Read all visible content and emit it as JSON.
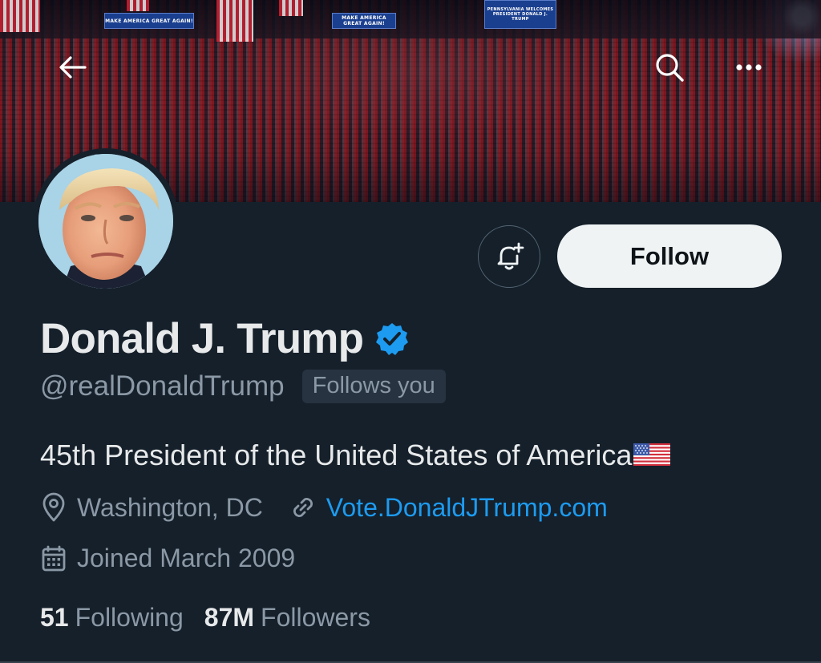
{
  "banner": {
    "signs": [
      "MAKE AMERICA GREAT AGAIN!",
      "MAKE AMERICA GREAT AGAIN!",
      "PENNSYLVANIA WELCOMES PRESIDENT DONALD J. TRUMP"
    ]
  },
  "nav": {
    "back_icon": "arrow-left-icon",
    "search_icon": "search-icon",
    "more_icon": "more-horizontal-icon"
  },
  "profile": {
    "display_name": "Donald J. Trump",
    "verified": true,
    "handle": "@realDonaldTrump",
    "follows_you_label": "Follows you",
    "bio": "45th President of the United States of America",
    "bio_emoji": "flag-usa",
    "location": "Washington, DC",
    "website": "Vote.DonaldJTrump.com",
    "joined": "Joined March 2009",
    "following_count": "51",
    "following_label": "Following",
    "followers_count": "87M",
    "followers_label": "Followers"
  },
  "actions": {
    "notify_icon": "bell-plus-icon",
    "follow_label": "Follow"
  },
  "colors": {
    "background": "#15202b",
    "text_primary": "#e7e9ea",
    "text_secondary": "#8b98a5",
    "link": "#1d9bf0",
    "verified": "#1d9bf0",
    "follow_button_bg": "#eff3f4",
    "follows_you_bg": "#273340"
  }
}
